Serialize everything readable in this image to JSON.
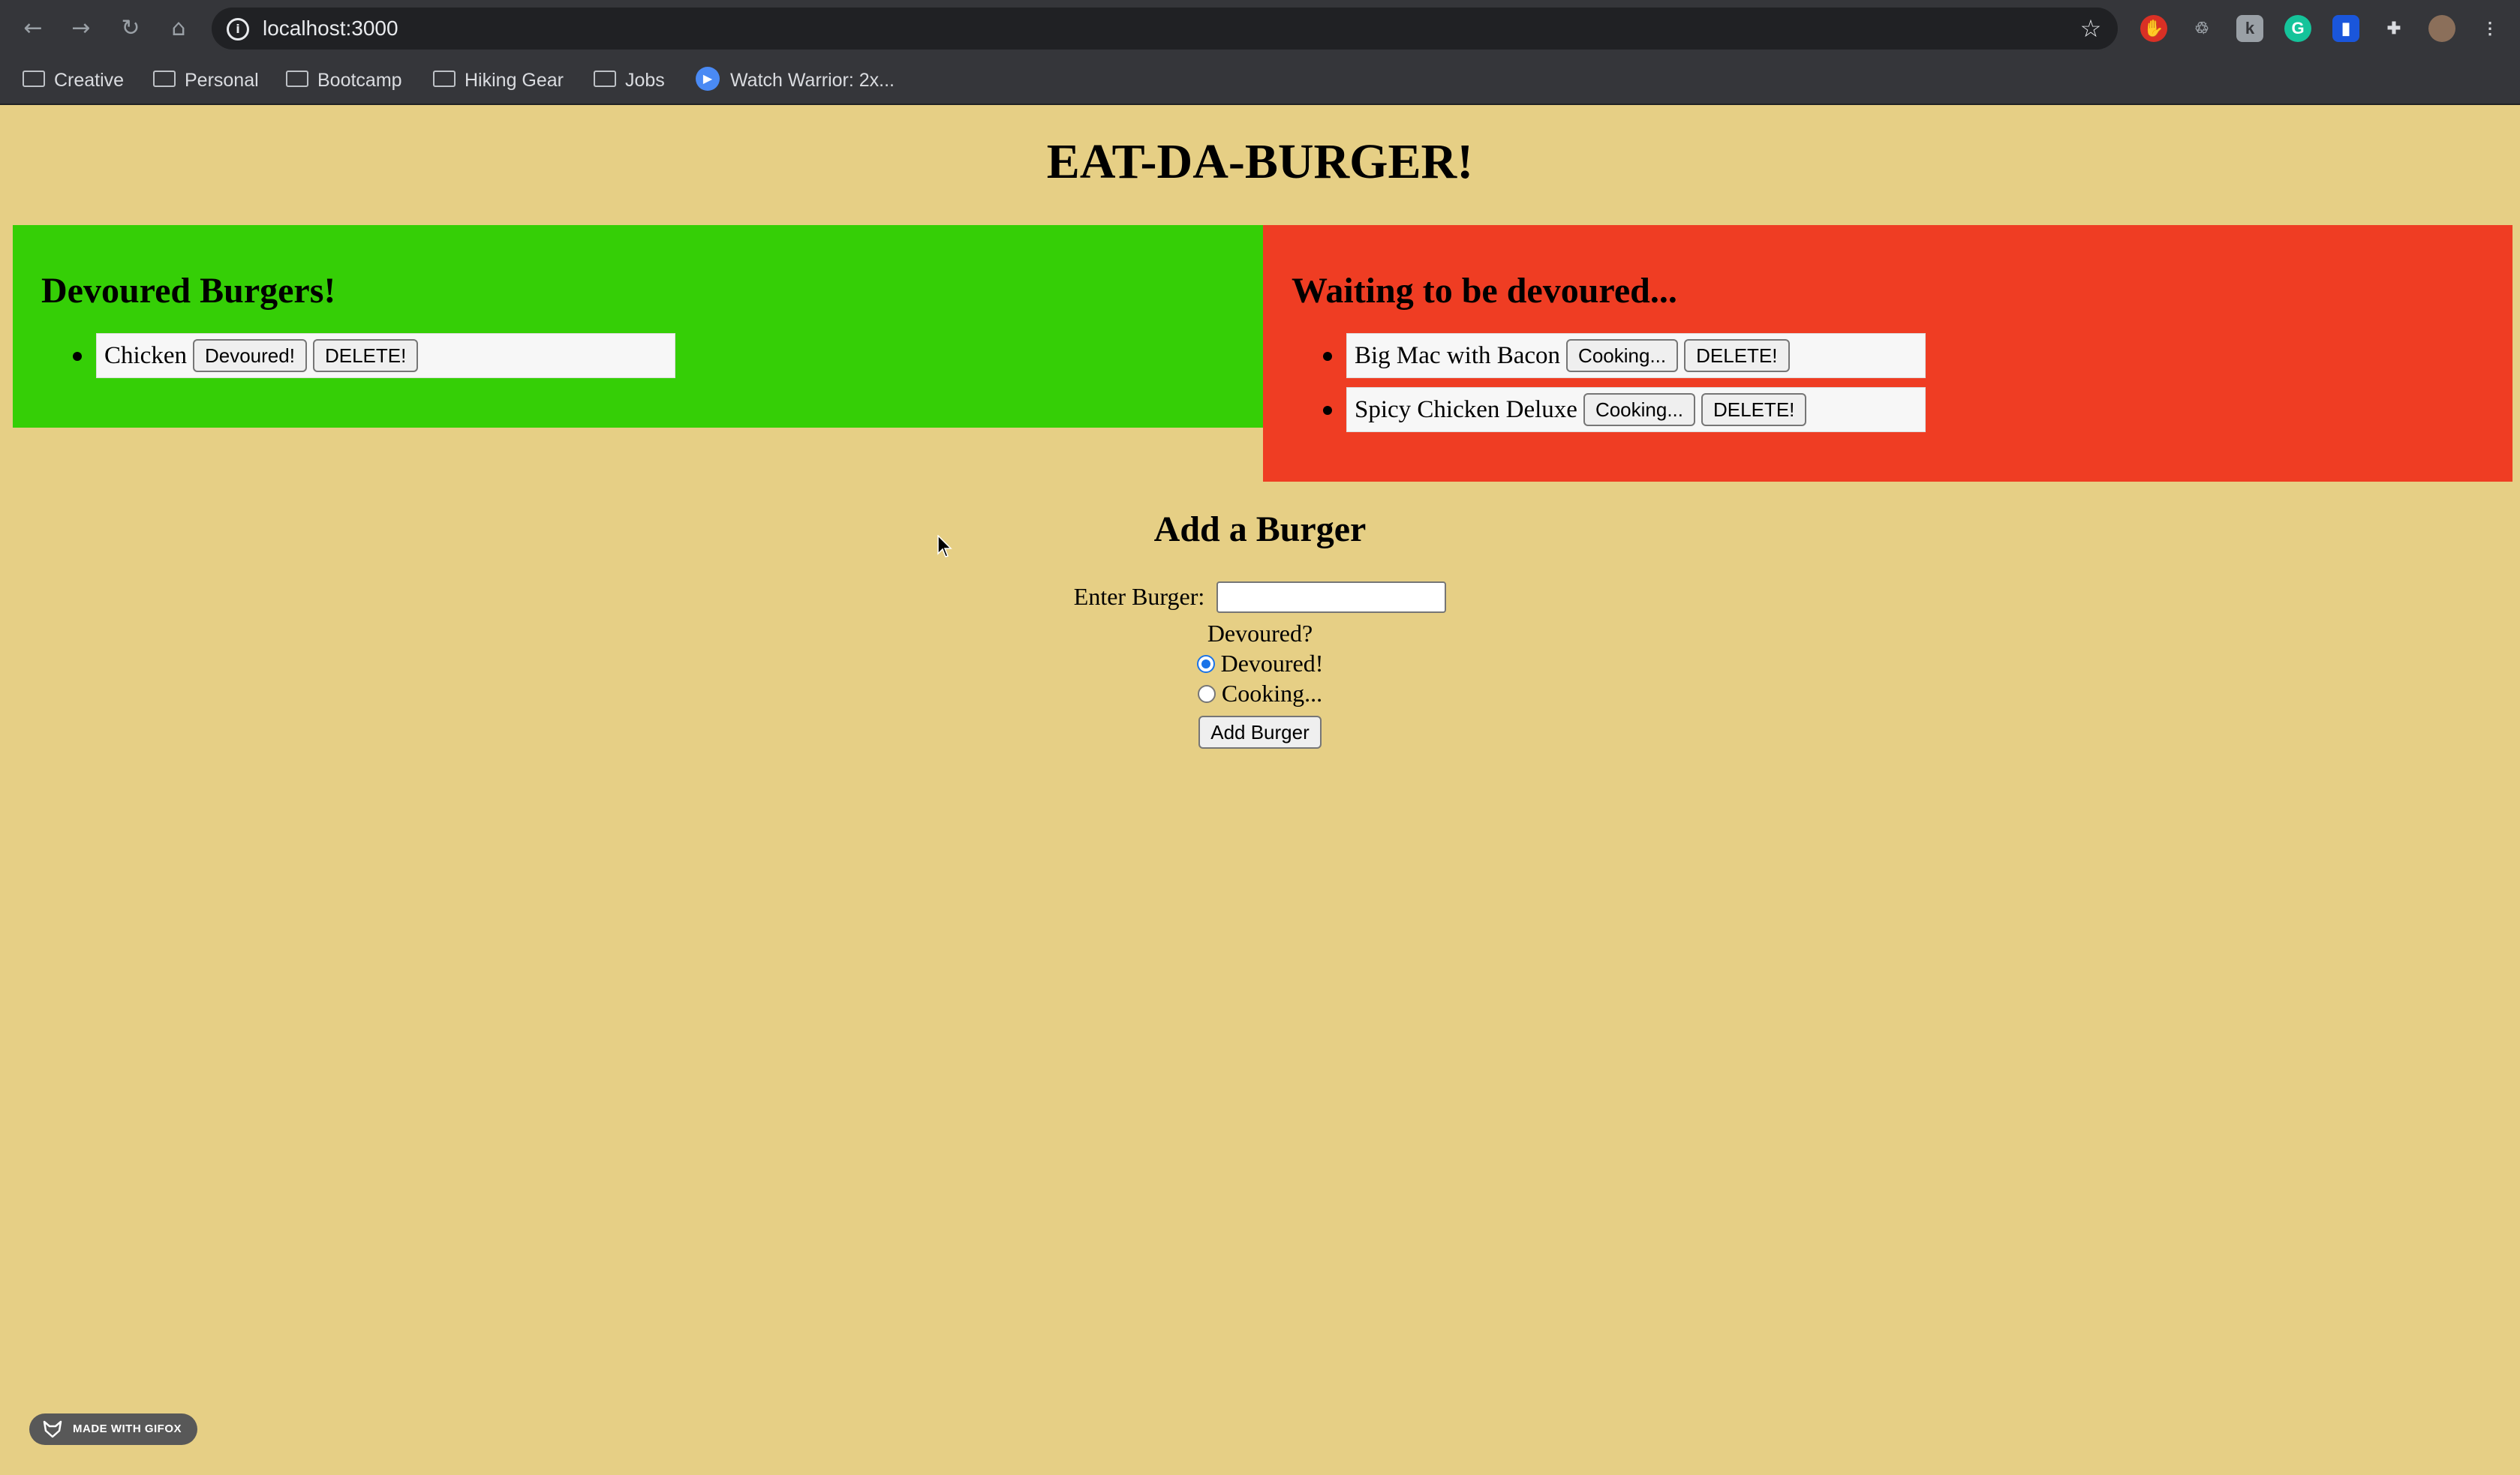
{
  "browser": {
    "url": "localhost:3000",
    "bookmarks": [
      "Creative",
      "Personal",
      "Bootcamp",
      "Hiking Gear",
      "Jobs",
      "Watch Warrior: 2x..."
    ]
  },
  "page": {
    "title": "EAT-DA-BURGER!",
    "devoured_panel": {
      "heading": "Devoured Burgers!",
      "color": "#35cf06",
      "items": [
        {
          "name": "Chicken",
          "state_button": "Devoured!",
          "delete_button": "DELETE!"
        }
      ]
    },
    "waiting_panel": {
      "heading": "Waiting to be devoured...",
      "color": "#ef3d23",
      "items": [
        {
          "name": "Big Mac with Bacon",
          "state_button": "Cooking...",
          "delete_button": "DELETE!"
        },
        {
          "name": "Spicy Chicken Deluxe",
          "state_button": "Cooking...",
          "delete_button": "DELETE!"
        }
      ]
    },
    "form": {
      "heading": "Add a Burger",
      "input_label": "Enter Burger:",
      "input_value": "",
      "question": "Devoured?",
      "options": [
        "Devoured!",
        "Cooking..."
      ],
      "selected_option": "Devoured!",
      "submit_label": "Add Burger"
    },
    "watermark": "MADE WITH GIFOX"
  }
}
